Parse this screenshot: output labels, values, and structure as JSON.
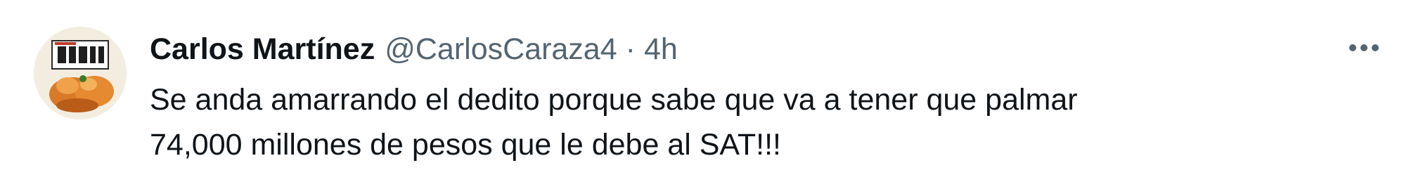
{
  "tweet": {
    "author": {
      "display_name": "Carlos Martínez",
      "handle": "@CarlosCaraza4",
      "avatar_icon": "avatar-food-plate"
    },
    "separator": "·",
    "timestamp": "4h",
    "more_icon": "more-options-icon",
    "text_lines": [
      "Se anda amarrando el dedito porque sabe que va a tener que palmar",
      "74,000 millones de pesos que le debe al SAT!!!"
    ]
  },
  "colors": {
    "text_primary": "#0f1419",
    "text_secondary": "#536471",
    "background": "#ffffff"
  }
}
